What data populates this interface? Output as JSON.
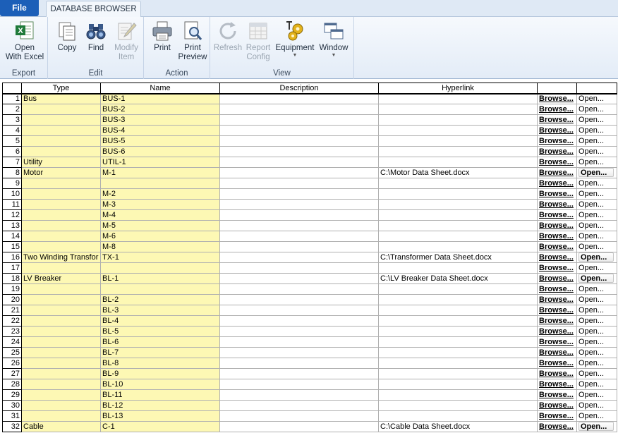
{
  "tabs": {
    "file": "File",
    "active": "DATABASE BROWSER"
  },
  "ribbon": {
    "groups": {
      "export": "Export",
      "edit": "Edit",
      "action": "Action",
      "view": "View"
    },
    "buttons": {
      "open_excel_1": "Open",
      "open_excel_2": "With Excel",
      "copy": "Copy",
      "find": "Find",
      "modify_1": "Modify",
      "modify_2": "Item",
      "print": "Print",
      "print_preview_1": "Print",
      "print_preview_2": "Preview",
      "refresh": "Refresh",
      "report_config_1": "Report",
      "report_config_2": "Config",
      "equipment": "Equipment",
      "window": "Window"
    }
  },
  "grid": {
    "headers": [
      "",
      "Type",
      "Name",
      "Description",
      "Hyperlink",
      "",
      ""
    ],
    "browse_label": "Browse...",
    "open_label": "Open...",
    "rows": [
      {
        "n": "1",
        "type": "Bus",
        "name": "BUS-1",
        "desc": "",
        "link": "",
        "boxed": false
      },
      {
        "n": "2",
        "type": "",
        "name": "BUS-2",
        "desc": "",
        "link": "",
        "boxed": false
      },
      {
        "n": "3",
        "type": "",
        "name": "BUS-3",
        "desc": "",
        "link": "",
        "boxed": false
      },
      {
        "n": "4",
        "type": "",
        "name": "BUS-4",
        "desc": "",
        "link": "",
        "boxed": false
      },
      {
        "n": "5",
        "type": "",
        "name": "BUS-5",
        "desc": "",
        "link": "",
        "boxed": false
      },
      {
        "n": "6",
        "type": "",
        "name": "BUS-6",
        "desc": "",
        "link": "",
        "boxed": false
      },
      {
        "n": "7",
        "type": "Utility",
        "name": "UTIL-1",
        "desc": "",
        "link": "",
        "boxed": false
      },
      {
        "n": "8",
        "type": "Motor",
        "name": "M-1",
        "desc": "",
        "link": "C:\\Motor Data Sheet.docx",
        "boxed": true
      },
      {
        "n": "9",
        "type": "",
        "name": "",
        "desc": "",
        "link": "",
        "boxed": false
      },
      {
        "n": "10",
        "type": "",
        "name": "M-2",
        "desc": "",
        "link": "",
        "boxed": false
      },
      {
        "n": "11",
        "type": "",
        "name": "M-3",
        "desc": "",
        "link": "",
        "boxed": false
      },
      {
        "n": "12",
        "type": "",
        "name": "M-4",
        "desc": "",
        "link": "",
        "boxed": false
      },
      {
        "n": "13",
        "type": "",
        "name": "M-5",
        "desc": "",
        "link": "",
        "boxed": false
      },
      {
        "n": "14",
        "type": "",
        "name": "M-6",
        "desc": "",
        "link": "",
        "boxed": false
      },
      {
        "n": "15",
        "type": "",
        "name": "M-8",
        "desc": "",
        "link": "",
        "boxed": false
      },
      {
        "n": "16",
        "type": "Two Winding Transfor",
        "name": "TX-1",
        "desc": "",
        "link": "C:\\Transformer Data Sheet.docx",
        "boxed": true
      },
      {
        "n": "17",
        "type": "",
        "name": "",
        "desc": "",
        "link": "",
        "boxed": false
      },
      {
        "n": "18",
        "type": "LV Breaker",
        "name": "BL-1",
        "desc": "",
        "link": "C:\\LV Breaker Data Sheet.docx",
        "boxed": true
      },
      {
        "n": "19",
        "type": "",
        "name": "",
        "desc": "",
        "link": "",
        "boxed": false
      },
      {
        "n": "20",
        "type": "",
        "name": "BL-2",
        "desc": "",
        "link": "",
        "boxed": false
      },
      {
        "n": "21",
        "type": "",
        "name": "BL-3",
        "desc": "",
        "link": "",
        "boxed": false
      },
      {
        "n": "22",
        "type": "",
        "name": "BL-4",
        "desc": "",
        "link": "",
        "boxed": false
      },
      {
        "n": "23",
        "type": "",
        "name": "BL-5",
        "desc": "",
        "link": "",
        "boxed": false
      },
      {
        "n": "24",
        "type": "",
        "name": "BL-6",
        "desc": "",
        "link": "",
        "boxed": false
      },
      {
        "n": "25",
        "type": "",
        "name": "BL-7",
        "desc": "",
        "link": "",
        "boxed": false
      },
      {
        "n": "26",
        "type": "",
        "name": "BL-8",
        "desc": "",
        "link": "",
        "boxed": false
      },
      {
        "n": "27",
        "type": "",
        "name": "BL-9",
        "desc": "",
        "link": "",
        "boxed": false
      },
      {
        "n": "28",
        "type": "",
        "name": "BL-10",
        "desc": "",
        "link": "",
        "boxed": false
      },
      {
        "n": "29",
        "type": "",
        "name": "BL-11",
        "desc": "",
        "link": "",
        "boxed": false
      },
      {
        "n": "30",
        "type": "",
        "name": "BL-12",
        "desc": "",
        "link": "",
        "boxed": false
      },
      {
        "n": "31",
        "type": "",
        "name": "BL-13",
        "desc": "",
        "link": "",
        "boxed": false
      },
      {
        "n": "32",
        "type": "Cable",
        "name": "C-1",
        "desc": "",
        "link": "C:\\Cable Data Sheet.docx",
        "boxed": true
      }
    ]
  }
}
